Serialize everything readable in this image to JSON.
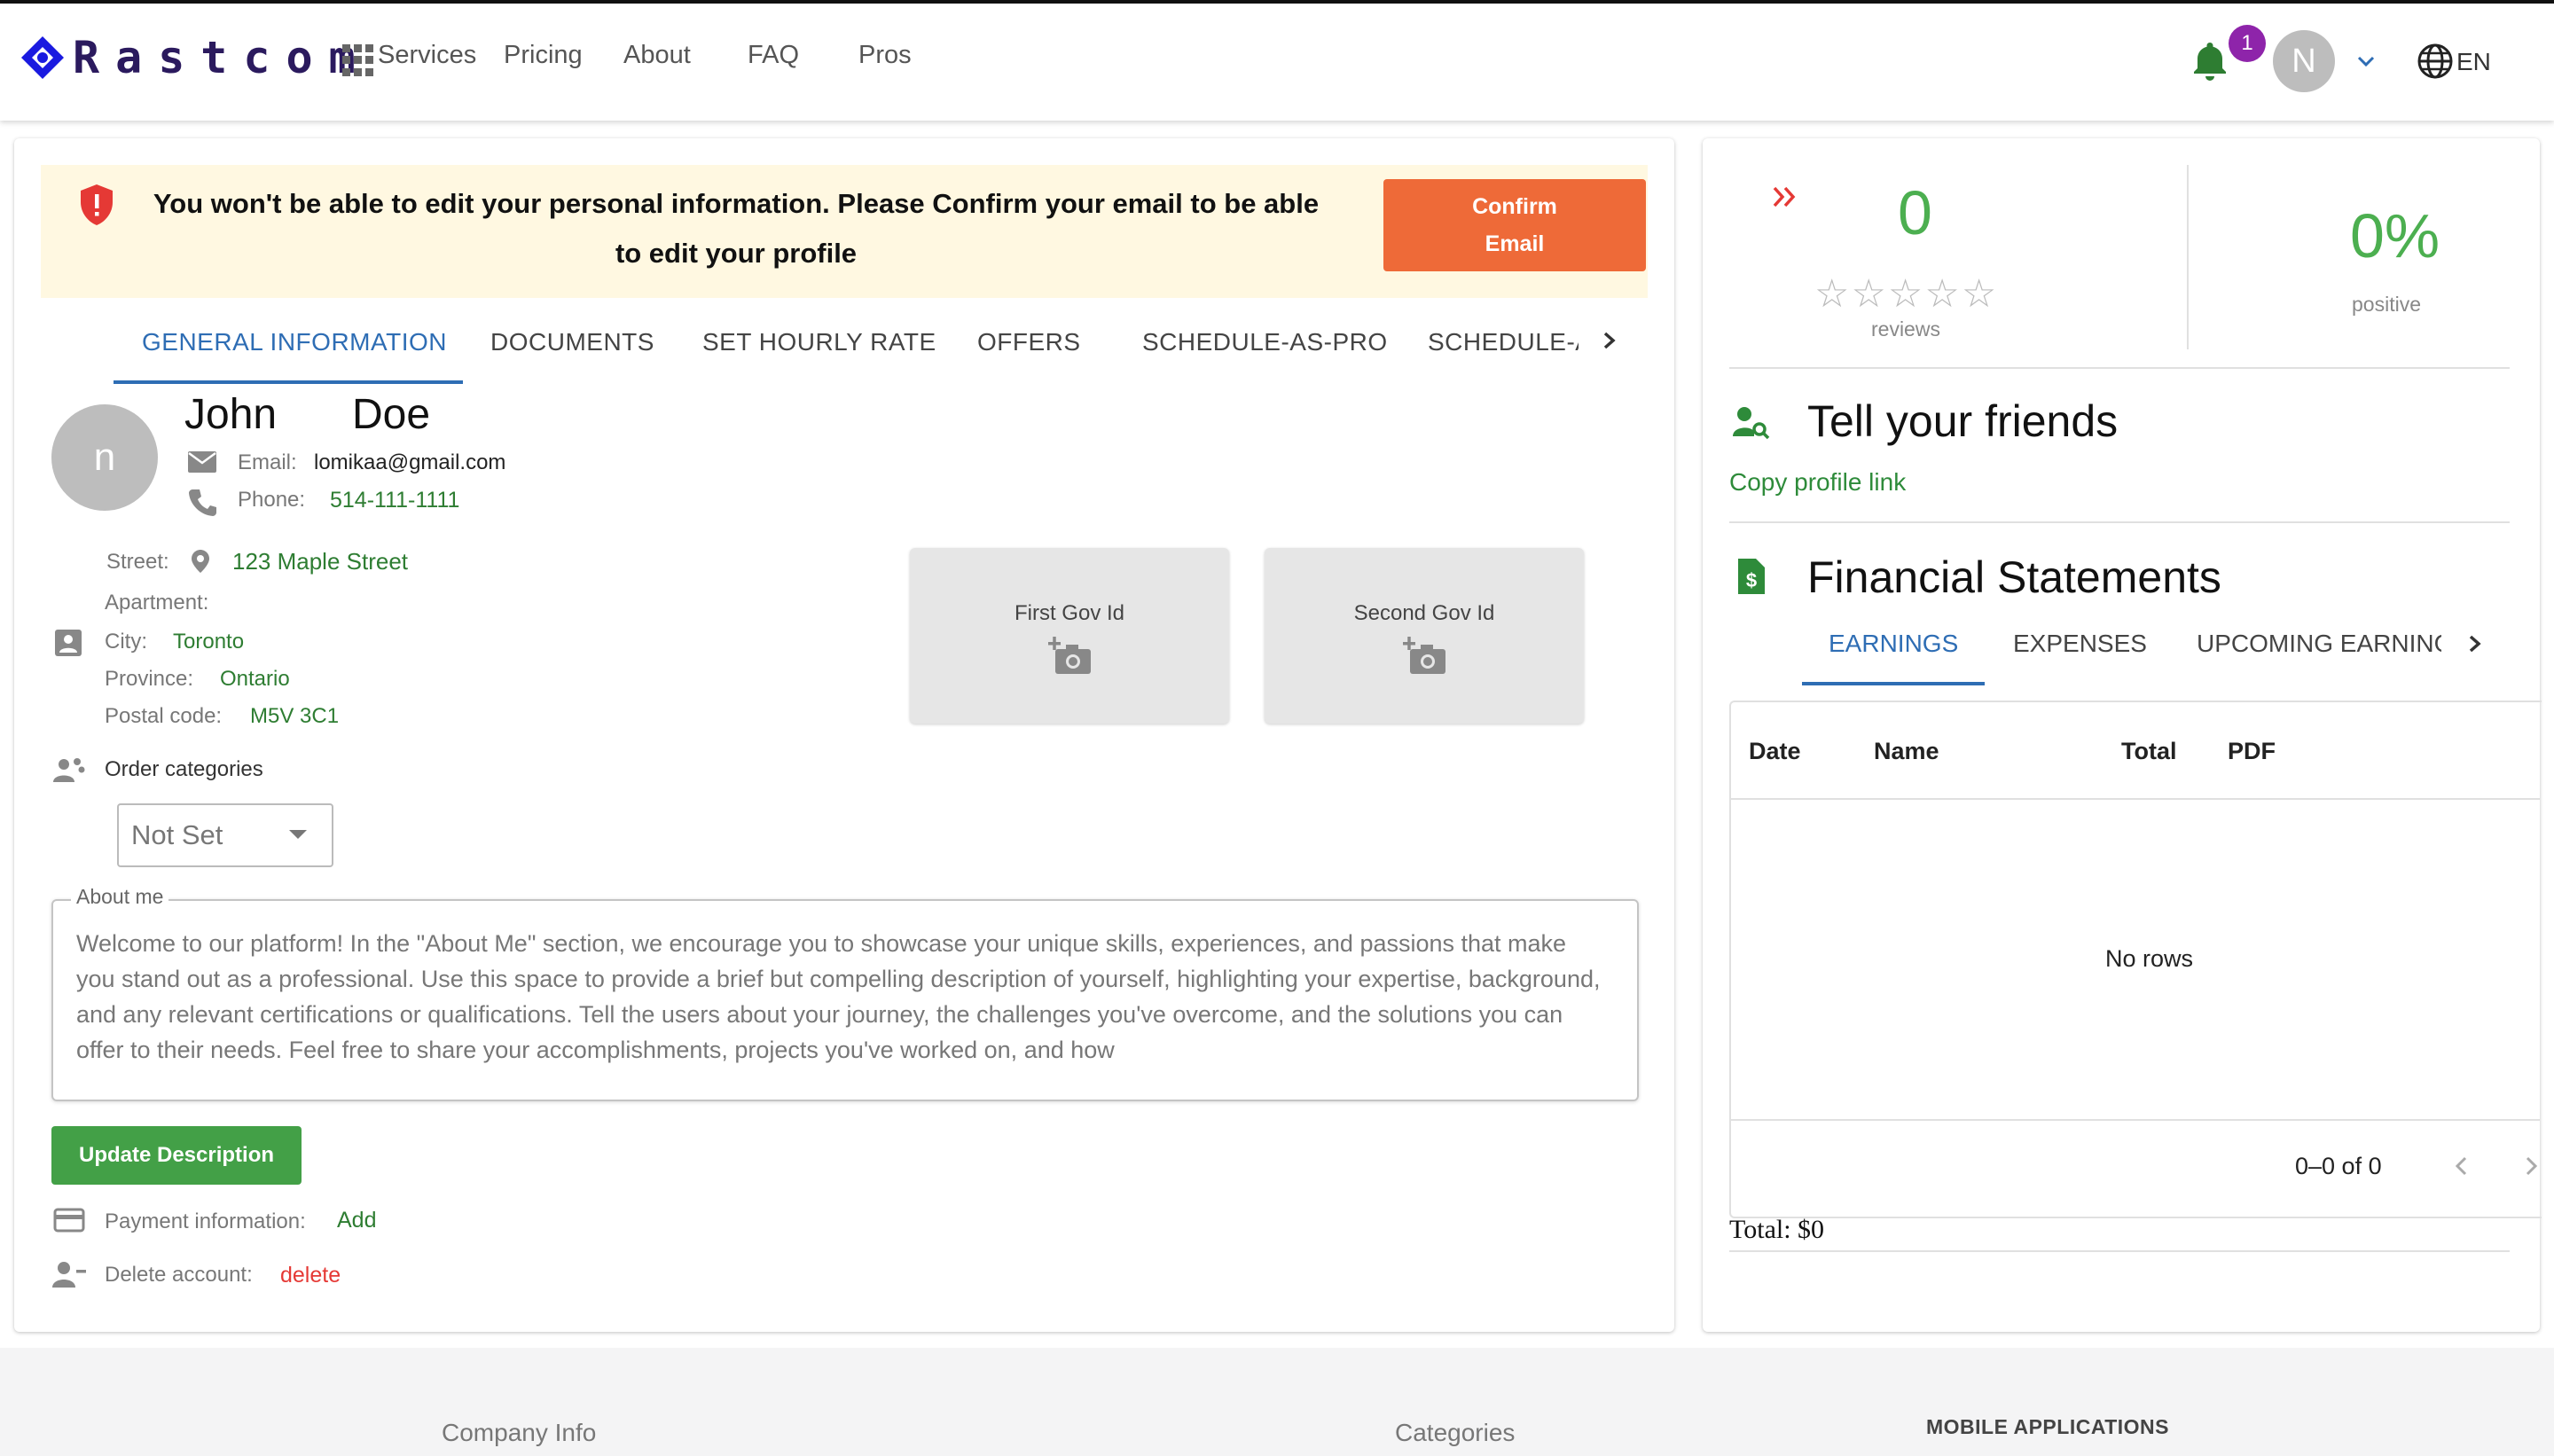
{
  "header": {
    "logo_text": "Rastcom",
    "nav": [
      "Services",
      "Pricing",
      "About",
      "FAQ",
      "Pros"
    ],
    "notification_count": "1",
    "user_initial": "N",
    "language": "EN"
  },
  "alert": {
    "message": "You won't be able to edit your personal information. Please Confirm your email to be able to edit your profile",
    "confirm_label": "Confirm Email"
  },
  "tabs": [
    "GENERAL INFORMATION",
    "DOCUMENTS",
    "SET HOURLY RATE",
    "OFFERS",
    "SCHEDULE-AS-PRO",
    "SCHEDULE-A"
  ],
  "active_tab": "GENERAL INFORMATION",
  "profile": {
    "avatar_initial": "n",
    "first_name": "John",
    "last_name": "Doe",
    "email_label": "Email:",
    "email": "lomikaa@gmail.com",
    "phone_label": "Phone:",
    "phone": "514-111-1111",
    "street_label": "Street:",
    "street": "123 Maple Street",
    "apartment_label": "Apartment:",
    "city_label": "City:",
    "city": "Toronto",
    "province_label": "Province:",
    "province": "Ontario",
    "postal_label": "Postal code:",
    "postal": "M5V 3C1"
  },
  "documents": {
    "first": "First Gov Id",
    "second": "Second Gov Id"
  },
  "order_categories": {
    "label": "Order categories",
    "value": "Not Set"
  },
  "about": {
    "legend": "About me",
    "text": "Welcome to our platform! In the \"About Me\" section, we encourage you to showcase your unique skills, experiences, and passions that make you stand out as a professional. Use this space to provide a brief but compelling description of yourself, highlighting your expertise, background, and any relevant certifications or qualifications. Tell the users about your journey, the challenges you've overcome, and the solutions you can offer to their needs. Feel free to share your accomplishments, projects you've worked on, and how",
    "update_label": "Update Description"
  },
  "payment": {
    "label": "Payment information:",
    "action": "Add"
  },
  "delete_account": {
    "label": "Delete account:",
    "action": "delete"
  },
  "stats": {
    "reviews_count": "0",
    "reviews_label": "reviews",
    "stars": 0,
    "positive_pct": "0%",
    "positive_label": "positive"
  },
  "friends": {
    "title": "Tell your friends",
    "copy_link": "Copy profile link"
  },
  "financial": {
    "title": "Financial Statements",
    "tabs": [
      "EARNINGS",
      "EXPENSES",
      "UPCOMING EARNING"
    ],
    "active_tab": "EARNINGS",
    "columns": [
      "Date",
      "Name",
      "Total",
      "PDF"
    ],
    "empty": "No rows",
    "pagination": "0–0 of 0",
    "total": "Total: $0"
  },
  "footer": {
    "company_info": "Company Info",
    "categories": "Categories",
    "mobile_apps": "MOBILE APPLICATIONS"
  },
  "colors": {
    "brand": "#2b1a5e",
    "primary": "#2e6db4",
    "success": "#43a047",
    "warning_bg": "#fff8e1",
    "confirm": "#ee6a38",
    "danger": "#e53935",
    "badge": "#8e24aa"
  }
}
